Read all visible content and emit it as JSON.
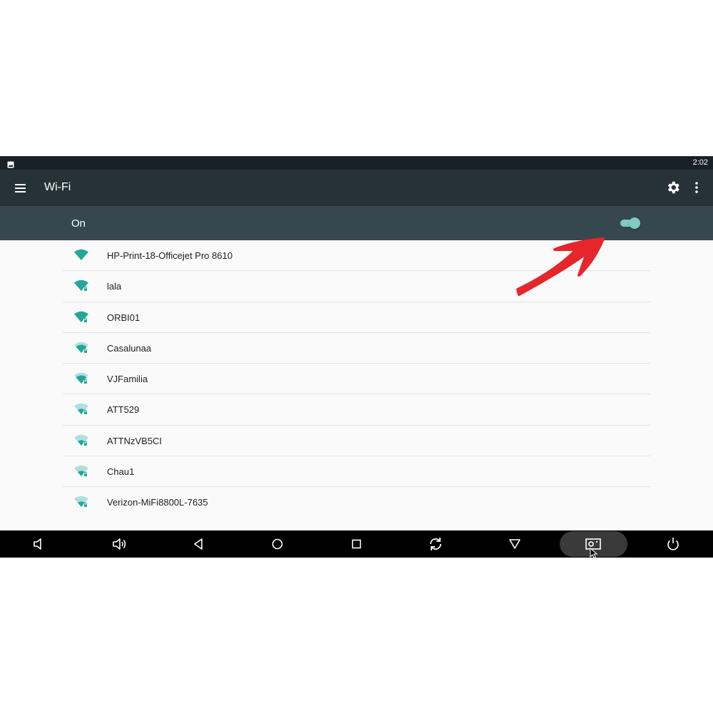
{
  "status_bar": {
    "time": "2:02",
    "notification_icon": "image-icon"
  },
  "toolbar": {
    "title": "Wi-Fi",
    "menu_icon": "hamburger-menu-icon",
    "settings_icon": "gear-icon",
    "more_icon": "overflow-menu-icon"
  },
  "master_switch": {
    "label": "On",
    "checked": true,
    "accent": "#80cbc4"
  },
  "networks": [
    {
      "ssid": "HP-Print-18-Officejet Pro 8610",
      "signal": 4,
      "locked": false
    },
    {
      "ssid": "lala",
      "signal": 4,
      "locked": true
    },
    {
      "ssid": "ORBI01",
      "signal": 4,
      "locked": true
    },
    {
      "ssid": "Casalunaa",
      "signal": 3,
      "locked": true
    },
    {
      "ssid": "VJFamilia",
      "signal": 3,
      "locked": true
    },
    {
      "ssid": "ATT529",
      "signal": 2,
      "locked": true
    },
    {
      "ssid": "ATTNzVB5CI",
      "signal": 2,
      "locked": true
    },
    {
      "ssid": "Chau1",
      "signal": 2,
      "locked": true
    },
    {
      "ssid": "Verizon-MiFi8800L-7635",
      "signal": 2,
      "locked": true
    }
  ],
  "nav_bar": {
    "buttons": [
      "volume-down-icon",
      "volume-up-icon",
      "back-icon",
      "home-icon",
      "recents-icon",
      "rotate-icon",
      "hide-nav-icon",
      "screenshot-icon",
      "power-icon"
    ],
    "active": "screenshot-icon"
  },
  "colors": {
    "status_bar": "#172127",
    "toolbar": "#263238",
    "switch_bar": "#37474f",
    "wifi_icon": "#26a69a",
    "annotation_arrow": "#e5262a"
  }
}
